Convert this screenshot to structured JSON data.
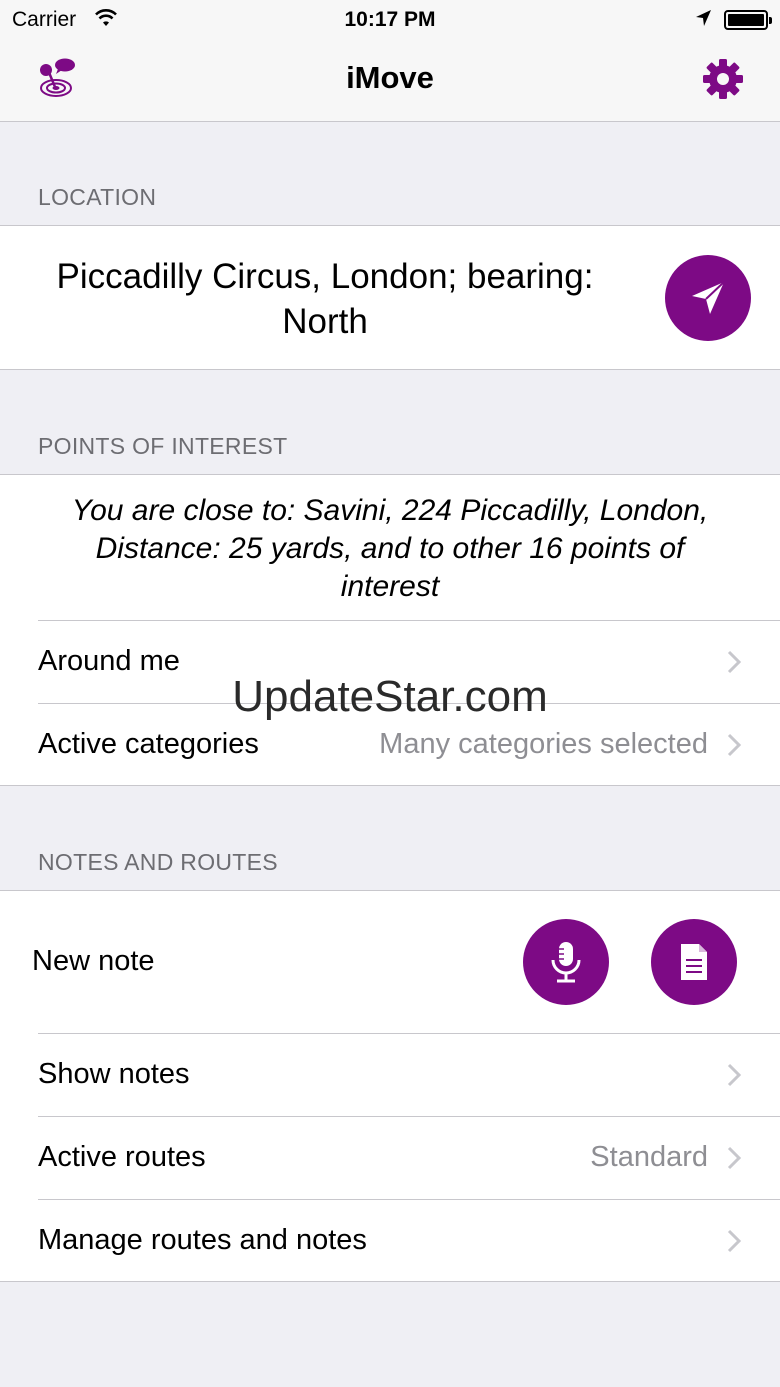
{
  "status_bar": {
    "carrier": "Carrier",
    "time": "10:17 PM"
  },
  "nav": {
    "title": "iMove",
    "logo_icon": "imove-logo-icon",
    "settings_icon": "gear-icon"
  },
  "location": {
    "header": "LOCATION",
    "line1": "Piccadilly Circus, London; bearing:",
    "line2": "North",
    "button_icon": "navigation-arrow-icon"
  },
  "poi": {
    "header": "POINTS OF INTEREST",
    "line1": "You are close to: Savini, 224 Piccadilly, London,",
    "line2": "Distance: 25 yards, and to other 16 points of",
    "line3": "interest",
    "around_me": "Around me",
    "active_categories": "Active categories",
    "active_categories_value": "Many categories selected"
  },
  "watermark": "UpdateStar.com",
  "notes": {
    "header": "NOTES AND ROUTES",
    "new_note": "New note",
    "show_notes": "Show notes",
    "active_routes": "Active routes",
    "active_routes_value": "Standard",
    "manage": "Manage routes and notes"
  },
  "colors": {
    "accent": "#7d0a85",
    "background": "#efeff4",
    "secondary_text": "#8e8e93"
  }
}
